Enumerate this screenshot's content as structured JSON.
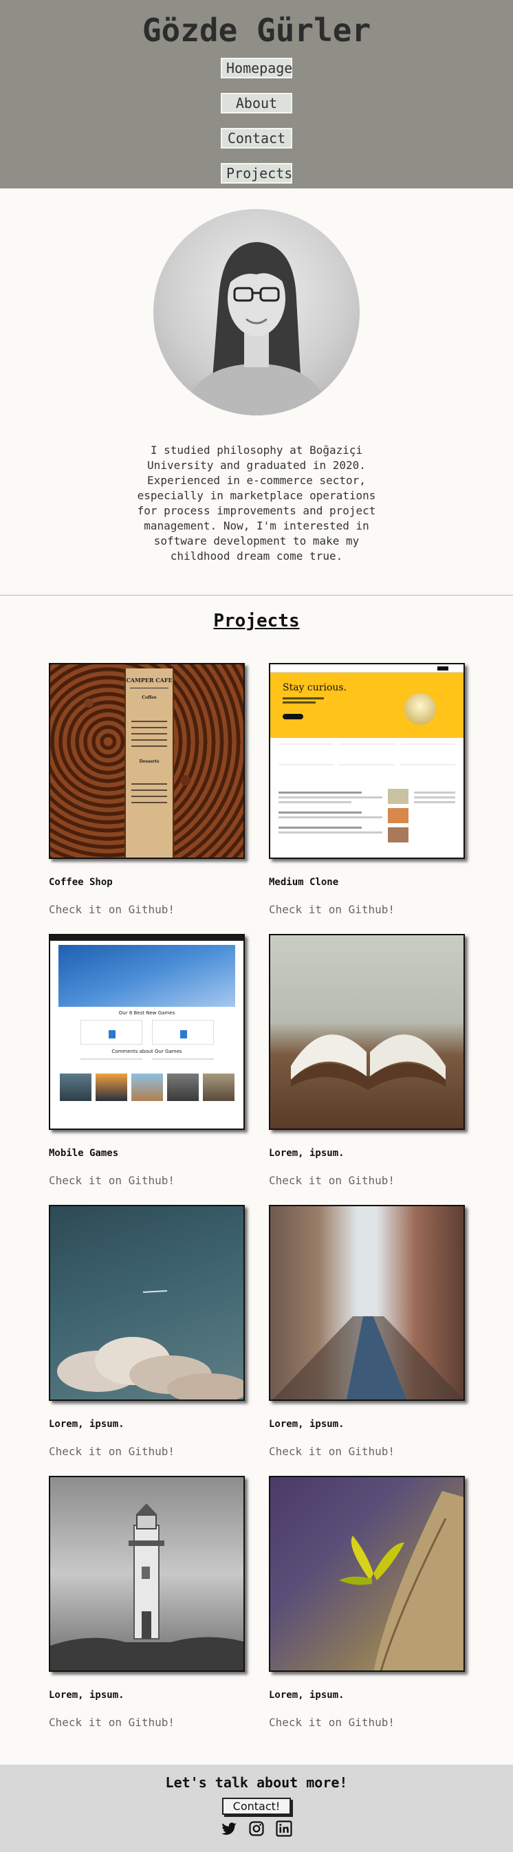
{
  "header": {
    "title": "Gözde Gürler",
    "nav": [
      {
        "label": "Homepage"
      },
      {
        "label": "About"
      },
      {
        "label": "Contact"
      },
      {
        "label": "Projects"
      }
    ]
  },
  "about": {
    "bio": "I studied philosophy at Boğaziçi University and graduated in 2020. Experienced in e-commerce sector, especially in marketplace operations for process improvements and project management. Now, I'm interested in software development to make my childhood dream come true."
  },
  "projects": {
    "title": "Projects",
    "items": [
      {
        "title": "Coffee Shop",
        "link": "Check it on Github!",
        "thumb": "coffee",
        "thumb_heading": "CAMPER CAFE",
        "thumb_sub": "Coffee",
        "thumb_sub2": "Desserts"
      },
      {
        "title": "Medium Clone",
        "link": "Check it on Github!",
        "thumb": "medium",
        "thumb_heading": "Stay curious."
      },
      {
        "title": "Mobile Games",
        "link": "Check it on Github!",
        "thumb": "mobile",
        "thumb_heading": "Our 8 Best New Games",
        "thumb_sub": "Comments about Our Games"
      },
      {
        "title": "Lorem, ipsum.",
        "link": "Check it on Github!",
        "thumb": "book"
      },
      {
        "title": "Lorem, ipsum.",
        "link": "Check it on Github!",
        "thumb": "sky"
      },
      {
        "title": "Lorem, ipsum.",
        "link": "Check it on Github!",
        "thumb": "street"
      },
      {
        "title": "Lorem, ipsum.",
        "link": "Check it on Github!",
        "thumb": "lighthouse"
      },
      {
        "title": "Lorem, ipsum.",
        "link": "Check it on Github!",
        "thumb": "plant"
      }
    ]
  },
  "footer": {
    "title": "Let's talk about more!",
    "button": "Contact!",
    "socials": [
      "twitter-icon",
      "instagram-icon",
      "linkedin-icon"
    ]
  },
  "colors": {
    "header_bg": "#8f8e87",
    "body_bg": "#fcfaf7",
    "footer_bg": "#d8d8d8"
  }
}
